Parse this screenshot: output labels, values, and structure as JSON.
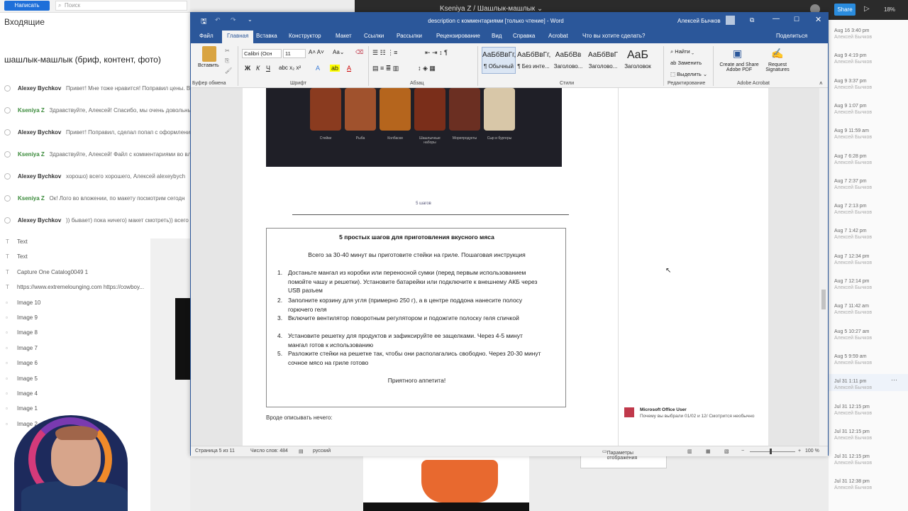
{
  "mail": {
    "compose": "Написать",
    "search_placeholder": "Поиск",
    "folder": "Входящие",
    "thread_title": "шашлык-машлык (бриф, контент, фото)",
    "messages": [
      {
        "author": "Alexey Bychkov",
        "text": "Привет! Мне тоже нравится! Поправил цены. В",
        "green": false
      },
      {
        "author": "Kseniya Z",
        "text": "Здравствуйте, Алексей! Спасибо, мы очень довольны",
        "green": true
      },
      {
        "author": "Alexey Bychkov",
        "text": "Привет! Поправил, сделал попап с оформлением",
        "green": false
      },
      {
        "author": "Kseniya Z",
        "text": "Здравствуйте, Алексей! Файл с комментариями во вл",
        "green": true
      },
      {
        "author": "Alexey Bychkov",
        "text": "хорошо) всего хорошего, Алексей alexeybych",
        "green": false
      },
      {
        "author": "Kseniya Z",
        "text": "Ок! Лого во вложении, по макету посмотрим сегодн",
        "green": true
      },
      {
        "author": "Alexey Bychkov",
        "text": ")) бывает) пока ничего) макет смотреть)) всего",
        "green": false
      }
    ]
  },
  "files": [
    "Text",
    "Text",
    "Capture One Catalog0049 1",
    "https://www.extremelounging.com https://cowboy...",
    "Image 10",
    "Image 9",
    "Image 8",
    "Image 7",
    "Image 6",
    "Image 5",
    "Image 4",
    "Image 1",
    "Image 2"
  ],
  "slack": {
    "user": "Kseniya Z",
    "project": "Шашлык-машлык",
    "share": "Share",
    "zoom": "18%"
  },
  "timeline": [
    {
      "t": "Aug 16 3:40 pm",
      "u": "Алексей Бычков"
    },
    {
      "t": "Aug 9 4:19 pm",
      "u": "Алексей Бычков"
    },
    {
      "t": "Aug 9 3:37 pm",
      "u": "Алексей Бычков"
    },
    {
      "t": "Aug 9 1:07 pm",
      "u": "Алексей Бычков"
    },
    {
      "t": "Aug 9 11:59 am",
      "u": "Алексей Бычков"
    },
    {
      "t": "Aug 7 6:28 pm",
      "u": "Алексей Бычков"
    },
    {
      "t": "Aug 7 2:37 pm",
      "u": "Алексей Бычков"
    },
    {
      "t": "Aug 7 2:13 pm",
      "u": "Алексей Бычков"
    },
    {
      "t": "Aug 7 1:42 pm",
      "u": "Алексей Бычков"
    },
    {
      "t": "Aug 7 12:34 pm",
      "u": "Алексей Бычков"
    },
    {
      "t": "Aug 7 12:14 pm",
      "u": "Алексей Бычков"
    },
    {
      "t": "Aug 7 11:42 am",
      "u": "Алексей Бычков"
    },
    {
      "t": "Aug 5 10:27 am",
      "u": "Алексей Бычков"
    },
    {
      "t": "Aug 5 9:59 am",
      "u": "Алексей Бычков"
    },
    {
      "t": "Jul 31 1:11 pm",
      "u": "Алексей Бычков"
    },
    {
      "t": "Jul 31 12:15 pm",
      "u": "Алексей Бычков"
    },
    {
      "t": "Jul 31 12:15 pm",
      "u": "Алексей Бычков"
    },
    {
      "t": "Jul 31 12:15 pm",
      "u": "Алексей Бычков"
    },
    {
      "t": "Jul 31 12:38 pm",
      "u": "Алексей Бычков"
    }
  ],
  "word": {
    "title": "description с комментариями [только чтение] - Word",
    "user": "Алексей Бычков",
    "tabs": [
      "Файл",
      "Главная",
      "Вставка",
      "Конструктор",
      "Макет",
      "Ссылки",
      "Рассылки",
      "Рецензирование",
      "Вид",
      "Справка",
      "Acrobat",
      "Что вы хотите сделать?",
      "Поделиться"
    ],
    "font": "Calibri (Осн",
    "size": "11",
    "paste": "Вставить",
    "groups": [
      "Буфер обмена",
      "Шрифт",
      "Абзац",
      "Стили",
      "Редактирование",
      "Adobe Acrobat"
    ],
    "styles": [
      {
        "p": "АаБбВвГг,",
        "n": "¶ Обычный"
      },
      {
        "p": "АаБбВвГг,",
        "n": "¶ Без инте..."
      },
      {
        "p": "АаБбВв",
        "n": "Заголово..."
      },
      {
        "p": "АаБбВвГ",
        "n": "Заголово..."
      },
      {
        "p": "AaБ",
        "n": "Заголовок"
      }
    ],
    "edit": [
      "Найти",
      "Заменить",
      "Выделить"
    ],
    "acrobat": [
      "Create and Share Adobe PDF",
      "Request Signatures"
    ],
    "meat_labels": [
      "Стейки",
      "Рыба",
      "Колбаски",
      "Шашлычные наборы",
      "Морепродукты",
      "Сыр и бургеры"
    ],
    "section_label": "5 шагов",
    "box_title": "5 простых шагов для приготовления вкусного мяса",
    "box_sub": "Всего за 30-40 минут вы приготовите стейки на гриле. Пошаговая инструкция",
    "steps": [
      "Достаньте мангал из коробки или переносной сумки (перед первым использованием помойте чашу и решетки). Установите батарейки или подключите к внешнему АКБ через USB разъем",
      "Заполните корзину для угля (примерно 250 г), а в центре поддона нанесите полосу горючего геля",
      "Включите вентилятор поворотным регулятором и подожгите полоску геля спичкой",
      "Установите решетку для продуктов и зафиксируйте ее защелками. Через 4-5 минут мангал готов к использованию",
      "Разложите стейки на решетке так, чтобы они располагались свободно. Через 20-30 минут сочное мясо на гриле готово"
    ],
    "enjoy": "Приятного аппетита!",
    "after": "Вроде описывать нечего:",
    "comment": {
      "name": "Microsoft Office User",
      "text": "Почему вы выбрали 01/02 и 12/ Смотрится необычно"
    },
    "status": {
      "page": "Страница 5 из 11",
      "words": "Число слов: 484",
      "lang": "русский",
      "view": "Параметры отображения",
      "zoom": "100 %"
    }
  }
}
